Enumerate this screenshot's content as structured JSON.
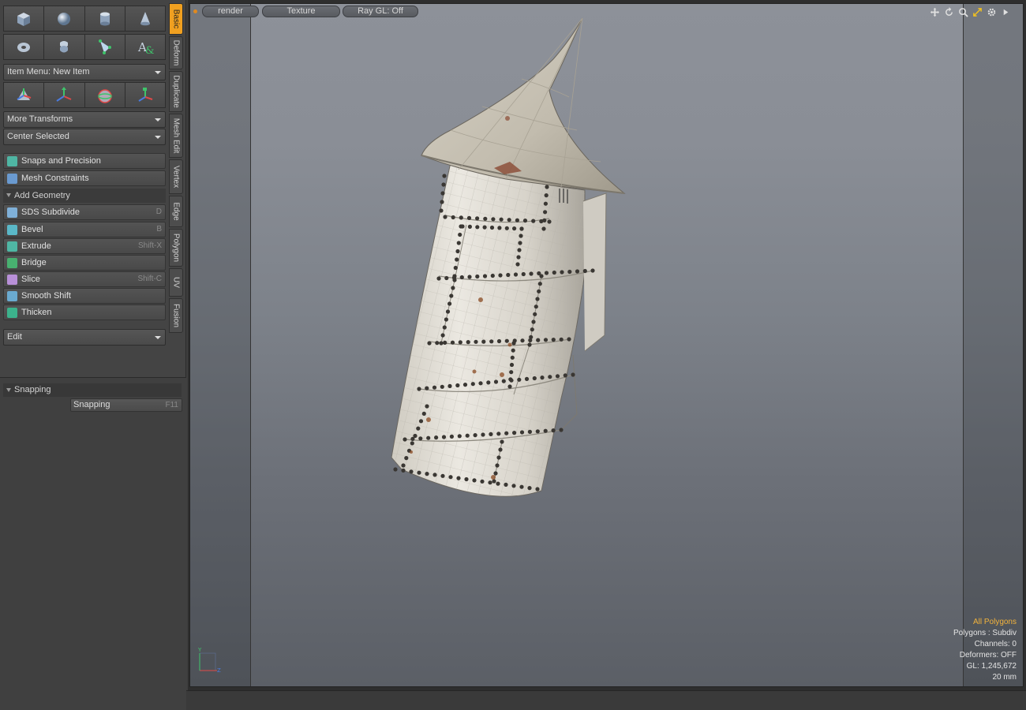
{
  "toolbar": {
    "primitive_icons": [
      "cube-icon",
      "sphere-icon",
      "cylinder-icon",
      "cone-icon"
    ],
    "primitive_icons_2": [
      "torus-icon",
      "capsule-icon",
      "pen-tool-icon",
      "text-tool-icon"
    ],
    "item_menu": "Item Menu: New Item",
    "transform_icons": [
      "transform-icon",
      "move-icon",
      "rotate-icon",
      "scale-icon"
    ],
    "more_transforms": "More Transforms",
    "center_selected": "Center Selected",
    "snaps": "Snaps and Precision",
    "mesh_constraints": "Mesh Constraints",
    "add_geometry": "Add Geometry",
    "tools": [
      {
        "label": "SDS Subdivide",
        "shortcut": "D",
        "color": "#7fb0d8"
      },
      {
        "label": "Bevel",
        "shortcut": "B",
        "color": "#5ab8c8"
      },
      {
        "label": "Extrude",
        "shortcut": "Shift-X",
        "color": "#4fb6a4"
      },
      {
        "label": "Bridge",
        "shortcut": "",
        "color": "#48b070"
      },
      {
        "label": "Slice",
        "shortcut": "Shift-C",
        "color": "#b890d8"
      },
      {
        "label": "Smooth Shift",
        "shortcut": "",
        "color": "#6aaad0"
      },
      {
        "label": "Thicken",
        "shortcut": "",
        "color": "#3cb28c"
      }
    ],
    "edit": "Edit"
  },
  "snapping": {
    "header": "Snapping",
    "button": "Snapping",
    "shortcut": "F11"
  },
  "tabs": [
    "Basic",
    "Deform",
    "Duplicate",
    "Mesh Edit",
    "Vertex",
    "Edge",
    "Polygon",
    "UV",
    "Fusion"
  ],
  "viewport": {
    "render": "render",
    "texture": "Texture",
    "raygl": "Ray GL: Off",
    "nav_icons": [
      "move-view-icon",
      "rotate-view-icon",
      "zoom-icon",
      "maximize-icon",
      "settings-icon",
      "menu-arrow-icon"
    ]
  },
  "stats": {
    "selection": "All Polygons",
    "polygons": "Polygons : Subdiv",
    "channels": "Channels: 0",
    "deformers": "Deformers: OFF",
    "gl": "GL: 1,245,672",
    "scale": "20 mm"
  },
  "colors": {
    "accent": "#f0a020",
    "stats_highlight": "#f2b33c"
  }
}
